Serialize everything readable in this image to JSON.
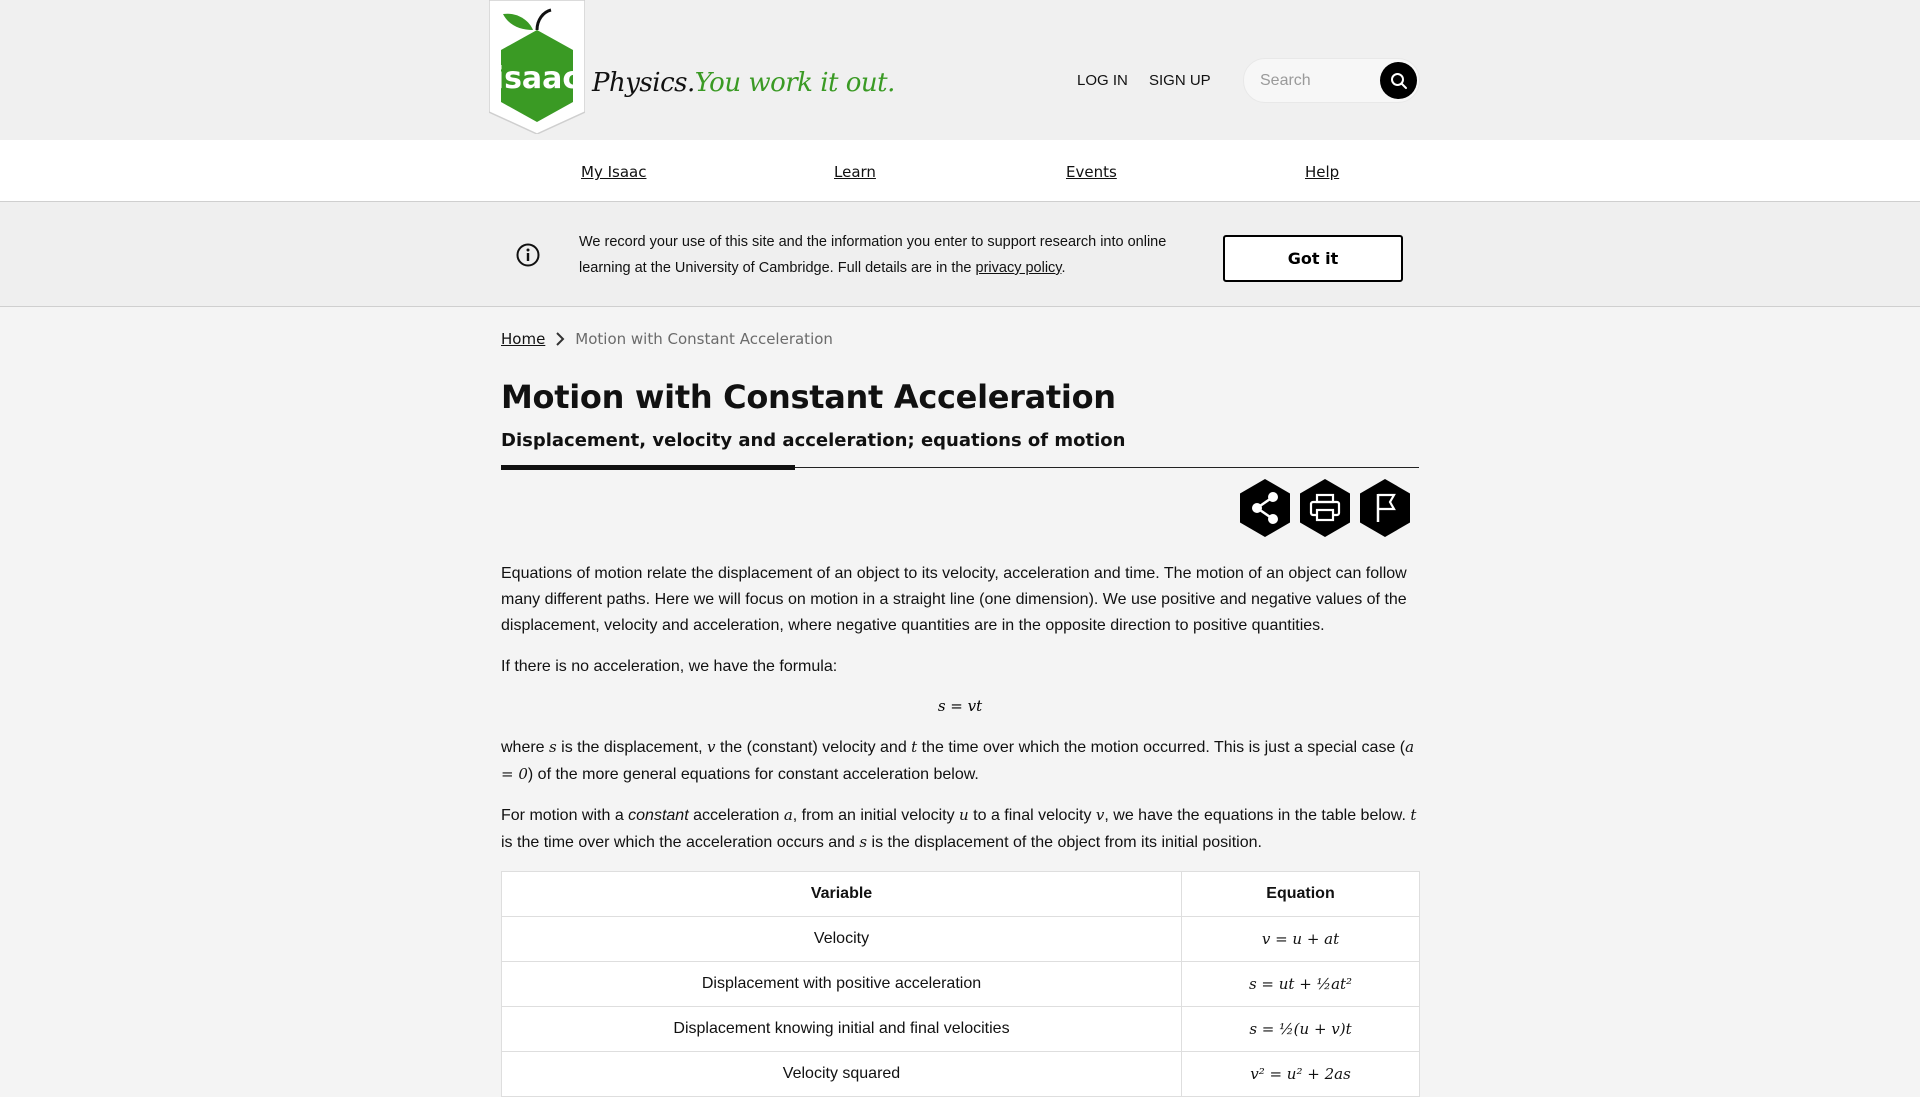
{
  "header": {
    "logo_text": "isaac",
    "tagline_primary": "Physics.",
    "tagline_secondary": "You work it out.",
    "login_label": "LOG IN",
    "signup_label": "SIGN UP",
    "search_placeholder": "Search"
  },
  "nav": {
    "items": [
      {
        "label": "My Isaac"
      },
      {
        "label": "Learn"
      },
      {
        "label": "Events"
      },
      {
        "label": "Help"
      }
    ]
  },
  "cookie_banner": {
    "text_before": "We record your use of this site and the information you enter to support research into online learning at the University of Cambridge. Full details are in the ",
    "link_label": "privacy policy",
    "text_after": ".",
    "button_label": "Got it"
  },
  "breadcrumb": {
    "home": "Home",
    "current": "Motion with Constant Acceleration"
  },
  "page": {
    "title": "Motion with Constant Acceleration",
    "subtitle": "Displacement, velocity and acceleration; equations of motion",
    "intro": "Equations of motion relate the displacement of an object to its velocity, acceleration and time. The motion of an object can follow many different paths. Here we will focus on motion in a straight line (one dimension). We use positive and negative values of the displacement, velocity and acceleration, where negative quantities are in the opposite direction to positive quantities.",
    "no_accel": "If there is no acceleration, we have the formula:",
    "formula_main": "s = vt",
    "where": {
      "p1": "where ",
      "s": "s",
      "p2": " is the displacement, ",
      "v": "v",
      "p3": " the (constant) velocity and ",
      "t": "t",
      "p4": " the time over which the motion occurred. This is just a special case (",
      "a0": "a = 0",
      "p5": ") of the more general equations for constant acceleration below."
    },
    "constant": {
      "p1": "For motion with a ",
      "em": "constant",
      "p2": " acceleration ",
      "a": "a",
      "p3": ", from an initial velocity ",
      "u": "u",
      "p4": " to a final velocity ",
      "v": "v",
      "p5": ", we have the equations in the table below. ",
      "t": "t",
      "p6": " is the time over which the acceleration occurs and ",
      "s": "s",
      "p7": " is the displacement of the object from its initial position."
    }
  },
  "table": {
    "headers": [
      "Variable",
      "Equation"
    ],
    "rows": [
      {
        "variable": "Velocity",
        "equation": "v = u + at"
      },
      {
        "variable": "Displacement with positive acceleration",
        "equation": "s = ut + ½at²"
      },
      {
        "variable": "Displacement knowing initial and final velocities",
        "equation": "s = ½(u + v)t"
      },
      {
        "variable": "Velocity squared",
        "equation": "v² = u² + 2as"
      }
    ]
  },
  "colors": {
    "brand_green": "#3a9a24",
    "dark": "#111111"
  },
  "icons": [
    "search-icon",
    "info-icon",
    "chevron-right-icon",
    "share-icon",
    "print-icon",
    "flag-icon",
    "apple-leaf-icon"
  ]
}
